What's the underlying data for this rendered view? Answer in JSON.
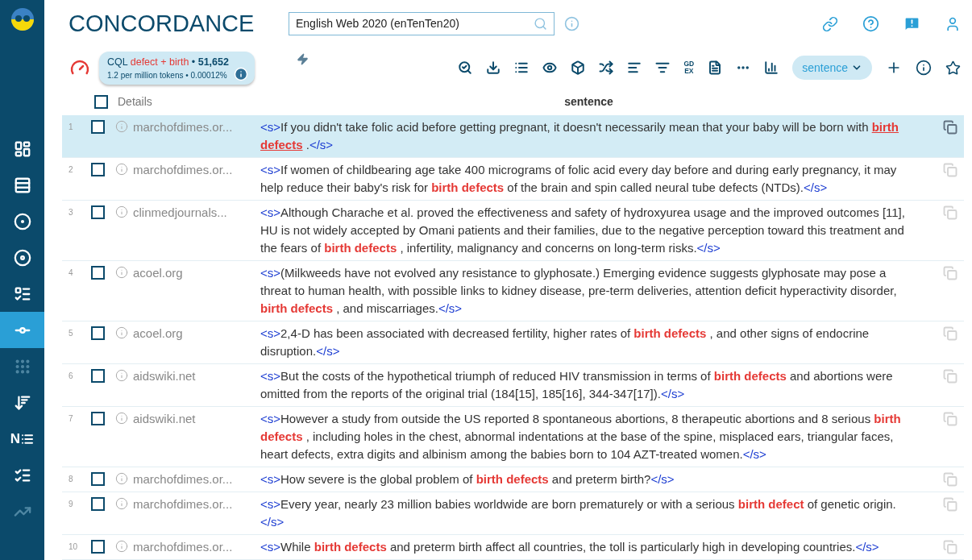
{
  "app": {
    "title": "CONCORDANCE"
  },
  "sidebar": {
    "items": [
      {
        "selected": false,
        "disabled": false
      },
      {
        "selected": false,
        "disabled": false
      },
      {
        "selected": false,
        "disabled": false
      },
      {
        "selected": false,
        "disabled": false
      },
      {
        "selected": false,
        "disabled": false
      },
      {
        "selected": true,
        "disabled": false
      },
      {
        "selected": false,
        "disabled": true
      },
      {
        "selected": false,
        "disabled": false
      },
      {
        "selected": false,
        "disabled": false,
        "glyph": "N"
      },
      {
        "selected": false,
        "disabled": false
      },
      {
        "selected": false,
        "disabled": true
      }
    ]
  },
  "corpus_field": {
    "value": "English Web 2020 (enTenTen20)"
  },
  "query": {
    "prefix": "CQL",
    "query": "defect + birth",
    "separator": "•",
    "count": "51,652",
    "stats": "1.2 per million tokens • 0.00012%"
  },
  "toolbar": {
    "gdex": [
      "GD",
      "EX"
    ],
    "view_select": "sentence"
  },
  "table": {
    "select_all_checked": false,
    "columns": [
      "Details",
      "sentence"
    ],
    "rows": [
      {
        "num": "1",
        "checked": false,
        "selected": true,
        "source": "marchofdimes.or...",
        "parts": [
          {
            "kind": "tag",
            "text": "<s>"
          },
          {
            "kind": "text",
            "text": "If you didn't take folic acid before getting pregnant, it doesn't necessarily mean that your baby will be born with"
          },
          {
            "kind": "keyword",
            "text": "birth defects"
          },
          {
            "kind": "text",
            "text": "."
          },
          {
            "kind": "tag",
            "text": "</s>"
          }
        ]
      },
      {
        "num": "2",
        "checked": false,
        "selected": false,
        "source": "marchofdimes.or...",
        "parts": [
          {
            "kind": "tag",
            "text": "<s>"
          },
          {
            "kind": "text",
            "text": "If women of childbearing age take 400 micrograms of folic acid every day before and during early pregnancy, it may help reduce their baby's risk for"
          },
          {
            "kind": "keyword",
            "text": "birth defects"
          },
          {
            "kind": "text",
            "text": "of the brain and spin called neural tube defects (NTDs)."
          },
          {
            "kind": "tag",
            "text": "</s>"
          }
        ]
      },
      {
        "num": "3",
        "checked": false,
        "selected": false,
        "source": "clinmedjournals...",
        "parts": [
          {
            "kind": "tag",
            "text": "<s>"
          },
          {
            "kind": "text",
            "text": "Although Charache et al. proved the effectiveness and safety of hydroxyurea usage and the improved outcomes [11], HU is not widely accepted by Omani patients and their families, due to the negative perception toward this treatment and the fears of"
          },
          {
            "kind": "keyword",
            "text": "birth defects"
          },
          {
            "kind": "text",
            "text": ", infertility, malignancy and concerns on long-term risks."
          },
          {
            "kind": "tag",
            "text": "</s>"
          }
        ]
      },
      {
        "num": "4",
        "checked": false,
        "selected": false,
        "source": "acoel.org",
        "parts": [
          {
            "kind": "tag",
            "text": "<s>"
          },
          {
            "kind": "text",
            "text": "(Milkweeds have not evolved any resistance to glyphosate.) Emerging evidence suggests glyphosate may pose a threat to human health, with possible links to kidney disease, pre-term deliveries, attention deficit hyperactivity disorder,"
          },
          {
            "kind": "keyword",
            "text": "birth defects"
          },
          {
            "kind": "text",
            "text": ", and miscarriages."
          },
          {
            "kind": "tag",
            "text": "</s>"
          }
        ]
      },
      {
        "num": "5",
        "checked": false,
        "selected": false,
        "source": "acoel.org",
        "parts": [
          {
            "kind": "tag",
            "text": "<s>"
          },
          {
            "kind": "text",
            "text": "2,4-D has been associated with decreased fertility, higher rates of"
          },
          {
            "kind": "keyword",
            "text": "birth defects"
          },
          {
            "kind": "text",
            "text": ", and other signs of endocrine disruption."
          },
          {
            "kind": "tag",
            "text": "</s>"
          }
        ]
      },
      {
        "num": "6",
        "checked": false,
        "selected": false,
        "source": "aidswiki.net",
        "parts": [
          {
            "kind": "tag",
            "text": "<s>"
          },
          {
            "kind": "text",
            "text": "But the costs of the hypothetical triumph of reduced HIV transmission in terms of"
          },
          {
            "kind": "keyword",
            "text": "birth defects"
          },
          {
            "kind": "text",
            "text": "and abortions were omitted from the reports of the original trial (184[15], 185[16], 344-347[17])."
          },
          {
            "kind": "tag",
            "text": "</s>"
          }
        ]
      },
      {
        "num": "7",
        "checked": false,
        "selected": false,
        "source": "aidswiki.net",
        "parts": [
          {
            "kind": "tag",
            "text": "<s>"
          },
          {
            "kind": "text",
            "text": "However a study from outside the US reported 8 spontaneous abortions, 8 therapeutic abortions and 8 serious"
          },
          {
            "kind": "keyword",
            "text": "birth defects"
          },
          {
            "kind": "text",
            "text": ", including holes in the chest, abnormal indentations at the base of the spine, misplaced ears, triangular faces, heart defects, extra digits and albinism among the babies born to 104 AZT-treated women."
          },
          {
            "kind": "tag",
            "text": "</s>"
          }
        ]
      },
      {
        "num": "8",
        "checked": false,
        "selected": false,
        "source": "marchofdimes.or...",
        "parts": [
          {
            "kind": "tag",
            "text": "<s>"
          },
          {
            "kind": "text",
            "text": "How severe is the global problem of"
          },
          {
            "kind": "keyword",
            "text": "birth defects"
          },
          {
            "kind": "text",
            "text": "and preterm birth?"
          },
          {
            "kind": "tag",
            "text": "</s>"
          }
        ]
      },
      {
        "num": "9",
        "checked": false,
        "selected": false,
        "source": "marchofdimes.or...",
        "parts": [
          {
            "kind": "tag",
            "text": "<s>"
          },
          {
            "kind": "text",
            "text": "Every year, nearly 23 million babies worldwide are born prematurely or with a serious"
          },
          {
            "kind": "keyword",
            "text": "birth defect"
          },
          {
            "kind": "text",
            "text": "of genetic origin."
          },
          {
            "kind": "tag",
            "text": "</s>"
          }
        ]
      },
      {
        "num": "10",
        "checked": false,
        "selected": false,
        "source": "marchofdimes.or...",
        "parts": [
          {
            "kind": "tag",
            "text": "<s>"
          },
          {
            "kind": "text",
            "text": "While"
          },
          {
            "kind": "keyword",
            "text": "birth defects"
          },
          {
            "kind": "text",
            "text": "and preterm birth affect all countries, the toll is particularly high in developing countries."
          },
          {
            "kind": "tag",
            "text": "</s>"
          }
        ]
      }
    ]
  }
}
